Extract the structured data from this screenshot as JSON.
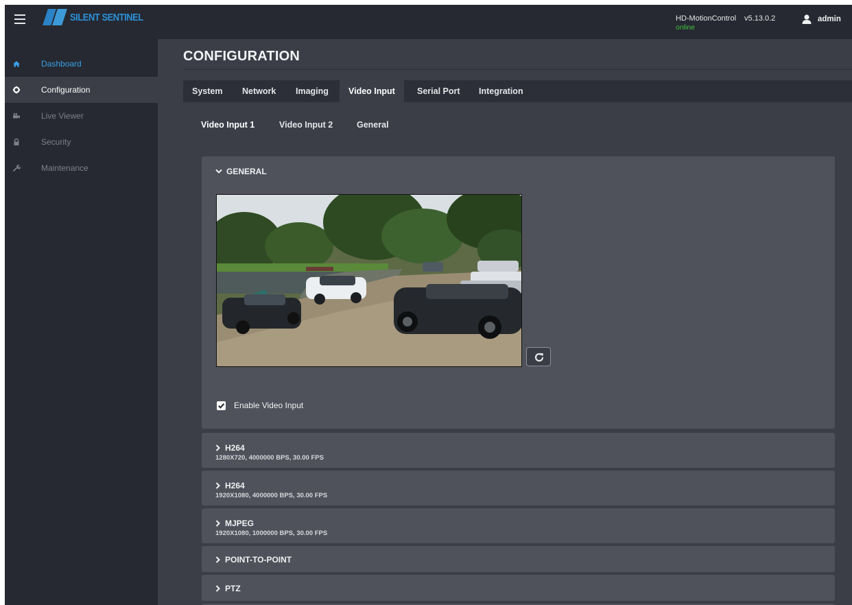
{
  "header": {
    "logo_text": "SILENT SENTINEL",
    "device_name": "HD-MotionControl",
    "version": "v5.13.0.2",
    "status": "online",
    "username": "admin",
    "colors": {
      "status_online": "#3ec43e",
      "link": "#3aa0e8"
    }
  },
  "sidebar": {
    "items": [
      {
        "label": "Dashboard",
        "icon": "home-icon"
      },
      {
        "label": "Configuration",
        "icon": "gear-icon"
      },
      {
        "label": "Live Viewer",
        "icon": "camera-icon"
      },
      {
        "label": "Security",
        "icon": "lock-icon"
      },
      {
        "label": "Maintenance",
        "icon": "wrench-icon"
      }
    ]
  },
  "main": {
    "title": "CONFIGURATION",
    "tabs": [
      "System",
      "Network",
      "Imaging",
      "Video Input",
      "Serial Port",
      "Integration"
    ],
    "active_tab": "Video Input",
    "subtabs": [
      "Video Input 1",
      "Video Input 2",
      "General"
    ],
    "active_subtab": "Video Input 1",
    "general": {
      "title": "GENERAL",
      "enable_label": "Enable Video Input",
      "enabled": true
    },
    "streams": [
      {
        "title": "H264",
        "details": "1280X720, 4000000 BPS, 30.00 FPS"
      },
      {
        "title": "H264",
        "details": "1920X1080, 4000000 BPS, 30.00 FPS"
      },
      {
        "title": "MJPEG",
        "details": "1920X1080, 1000000 BPS, 30.00 FPS"
      }
    ],
    "sections": [
      {
        "title": "POINT-TO-POINT"
      },
      {
        "title": "PTZ"
      }
    ]
  }
}
